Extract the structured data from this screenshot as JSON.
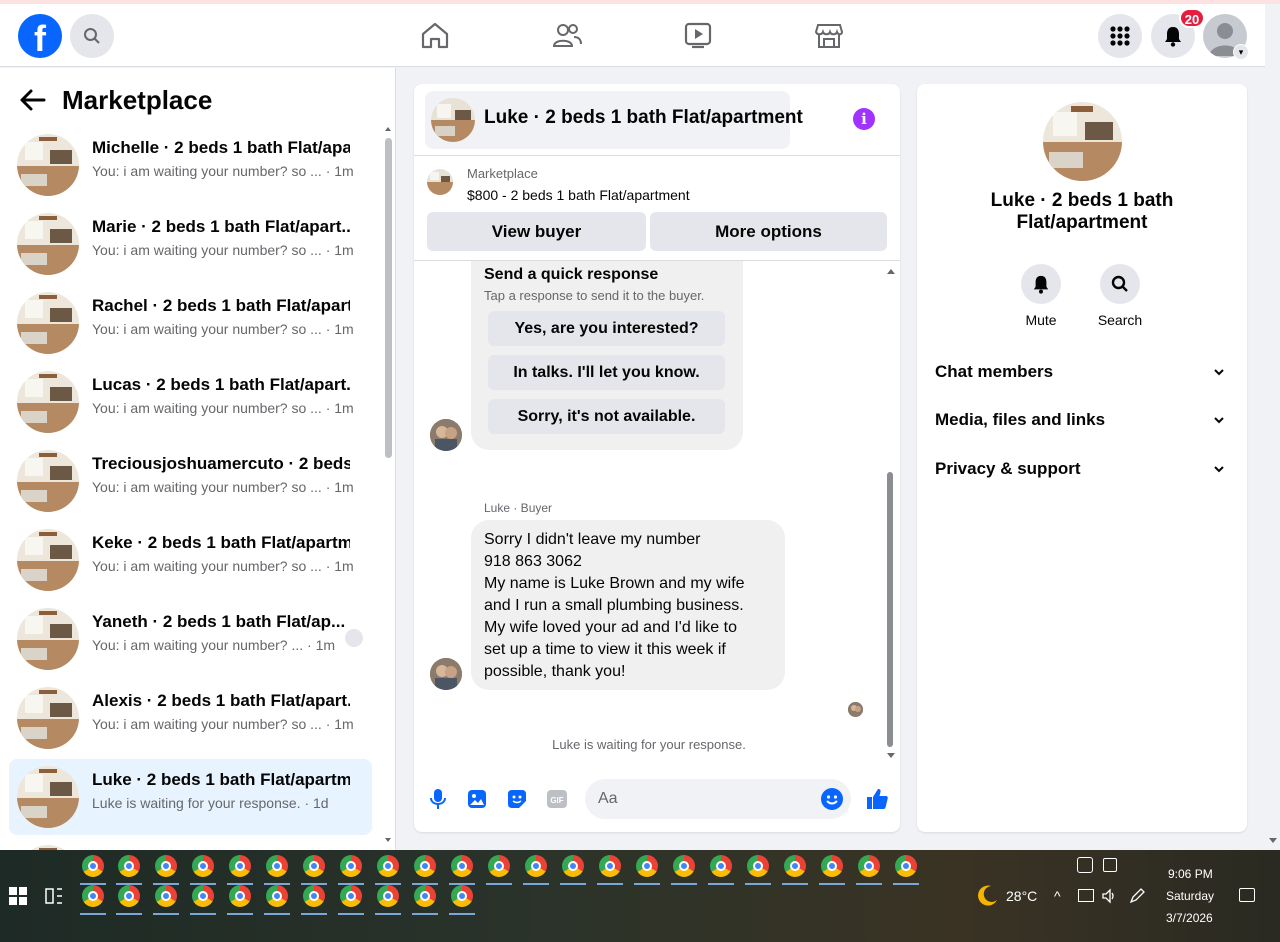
{
  "nav": {
    "logo_letter": "f",
    "notifications_count": "20"
  },
  "left": {
    "title": "Marketplace",
    "conversations": [
      {
        "name": "Michelle · 2 beds 1 bath Flat/apa...",
        "snippet": "You: i am waiting your number? so ... · 1m"
      },
      {
        "name": "Marie · 2 beds 1 bath Flat/apart...",
        "snippet": "You: i am waiting your number? so ... · 1m"
      },
      {
        "name": "Rachel · 2 beds 1 bath Flat/apart...",
        "snippet": "You: i am waiting your number? so ... · 1m"
      },
      {
        "name": "Lucas · 2 beds 1 bath Flat/apart...",
        "snippet": "You: i am waiting your number? so ... · 1m"
      },
      {
        "name": "Treciousjoshuamercuto · 2 beds ...",
        "snippet": "You: i am waiting your number? so ... · 1m"
      },
      {
        "name": "Keke · 2 beds 1 bath Flat/apartm...",
        "snippet": "You: i am waiting your number? so ... · 1m"
      },
      {
        "name": "Yaneth · 2 beds 1 bath Flat/ap...",
        "snippet": "You: i am waiting your number? ... · 1m"
      },
      {
        "name": "Alexis · 2 beds 1 bath Flat/apart...",
        "snippet": "You: i am waiting your number? so ... · 1m"
      },
      {
        "name": "Luke · 2 beds 1 bath Flat/apartm...",
        "snippet": "Luke is waiting for your response. · 1d"
      }
    ]
  },
  "chat": {
    "title": "Luke · 2 beds 1 bath Flat/apartment",
    "listing_source": "Marketplace",
    "listing_price": "$800 - 2 beds 1 bath Flat/apartment",
    "view_buyer": "View buyer",
    "more_options": "More options",
    "quick_title": "Send a quick response",
    "quick_sub": "Tap a response to send it to the buyer.",
    "quick_1": "Yes, are you interested?",
    "quick_2": "In talks. I'll let you know.",
    "quick_3": "Sorry, it's not available.",
    "sender": "Luke · Buyer",
    "message_lines": [
      "Sorry I didn't leave my number",
      "918 863 3062",
      "My name is Luke Brown and my wife",
      "and I run a small plumbing business.",
      "My wife loved your ad and I'd like to",
      "set up a time to view it this week if",
      "possible, thank you!"
    ],
    "waiting": "Luke is waiting for your response.",
    "input_placeholder": "Aa"
  },
  "right": {
    "name_line1": "Luke · 2 beds 1 bath",
    "name_line2": "Flat/apartment",
    "mute": "Mute",
    "search": "Search",
    "chat_members": "Chat members",
    "media": "Media, files and links",
    "privacy": "Privacy & support"
  },
  "taskbar": {
    "weather": "28°C",
    "time": "9:06 PM",
    "day": "Saturday",
    "date": "3/7/2026"
  },
  "colors": {
    "accent": "#0866ff",
    "badge": "#e41e3f",
    "info": "#a033ff",
    "selected": "#e7f3ff"
  }
}
